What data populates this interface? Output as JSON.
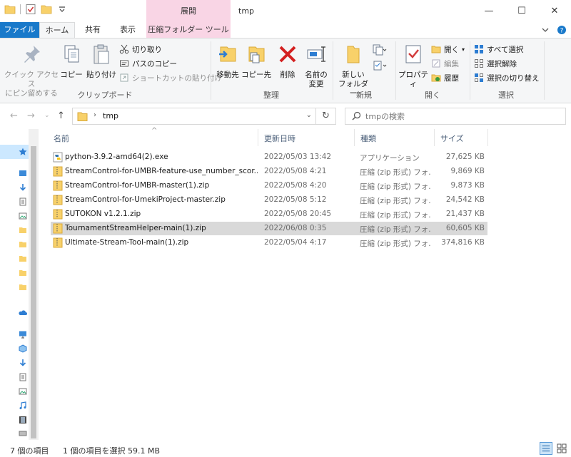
{
  "window": {
    "title": "tmp",
    "contextual_tab_header": "展開",
    "minimize": "—",
    "maximize": "☐",
    "close": "✕"
  },
  "tabs": [
    {
      "label": "ファイル"
    },
    {
      "label": "ホーム"
    },
    {
      "label": "共有"
    },
    {
      "label": "表示"
    },
    {
      "label": "圧縮フォルダー ツール"
    }
  ],
  "ribbon": {
    "clipboard": {
      "label": "クリップボード",
      "pin_quick_access": "クイック アクセス\nにピン留めする",
      "copy": "コピー",
      "paste": "貼り付け",
      "cut": "切り取り",
      "copy_path": "パスのコピー",
      "paste_shortcut": "ショートカットの貼り付け"
    },
    "organize": {
      "label": "整理",
      "move_to": "移動先",
      "copy_to": "コピー先",
      "delete": "削除",
      "rename": "名前の\n変更"
    },
    "new": {
      "label": "新規",
      "new_folder": "新しい\nフォルダー"
    },
    "open": {
      "label": "開く",
      "properties": "プロパティ",
      "open": "開く",
      "edit": "編集",
      "history": "履歴"
    },
    "select": {
      "label": "選択",
      "select_all": "すべて選択",
      "select_none": "選択解除",
      "invert_selection": "選択の切り替え"
    }
  },
  "address": {
    "path": "tmp",
    "search_placeholder": "tmpの検索"
  },
  "columns": {
    "name": "名前",
    "date": "更新日時",
    "type": "種類",
    "size": "サイズ"
  },
  "files": [
    {
      "name": "python-3.9.2-amd64(2).exe",
      "date": "2022/05/03 13:42",
      "type": "アプリケーション",
      "size": "27,625 KB",
      "kind": "exe"
    },
    {
      "name": "StreamControl-for-UMBR-feature-use_number_scor...",
      "date": "2022/05/08 4:21",
      "type": "圧縮 (zip 形式) フォ...",
      "size": "9,869 KB",
      "kind": "zip"
    },
    {
      "name": "StreamControl-for-UMBR-master(1).zip",
      "date": "2022/05/08 4:20",
      "type": "圧縮 (zip 形式) フォ...",
      "size": "9,873 KB",
      "kind": "zip"
    },
    {
      "name": "StreamControl-for-UmekiProject-master.zip",
      "date": "2022/05/08 5:12",
      "type": "圧縮 (zip 形式) フォ...",
      "size": "24,542 KB",
      "kind": "zip"
    },
    {
      "name": "SUTOKON v1.2.1.zip",
      "date": "2022/05/08 20:45",
      "type": "圧縮 (zip 形式) フォ...",
      "size": "21,437 KB",
      "kind": "zip"
    },
    {
      "name": "TournamentStreamHelper-main(1).zip",
      "date": "2022/06/08 0:35",
      "type": "圧縮 (zip 形式) フォ...",
      "size": "60,605 KB",
      "kind": "zip",
      "selected": true
    },
    {
      "name": "Ultimate-Stream-Tool-main(1).zip",
      "date": "2022/05/04 4:17",
      "type": "圧縮 (zip 形式) フォ...",
      "size": "374,816 KB",
      "kind": "zip"
    }
  ],
  "status": {
    "item_count": "7 個の項目",
    "selection": "1 個の項目を選択  59.1 MB"
  },
  "colors": {
    "file_tab": "#1979ca",
    "context_tab": "#f9d5e5",
    "selected_row": "#d9d9d9",
    "ribbon_bg": "#f5f6f7",
    "delete_red": "#d42020",
    "folder_yellow": "#f8d16a"
  }
}
